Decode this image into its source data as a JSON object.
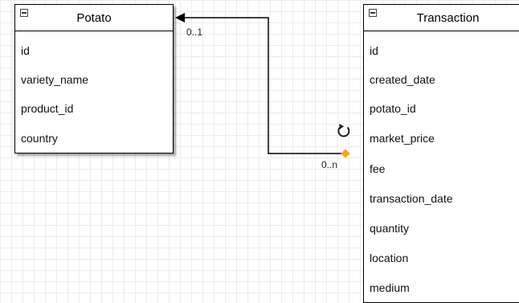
{
  "potato": {
    "title": "Potato",
    "fields": [
      "id",
      "variety_name",
      "product_id",
      "country"
    ]
  },
  "transaction": {
    "title": "Transaction",
    "fields": [
      "id",
      "created_date",
      "potato_id",
      "market_price",
      "fee",
      "transaction_date",
      "quantity",
      "location",
      "medium"
    ]
  },
  "relationship": {
    "potato_multiplicity": "0..1",
    "transaction_multiplicity": "0..n"
  },
  "colors": {
    "grid": "#ececec",
    "line": "#000000",
    "handle": "#f5a623"
  },
  "icons": {
    "collapse": "collapse-minus-icon",
    "rotate": "rotate-handle-icon"
  }
}
